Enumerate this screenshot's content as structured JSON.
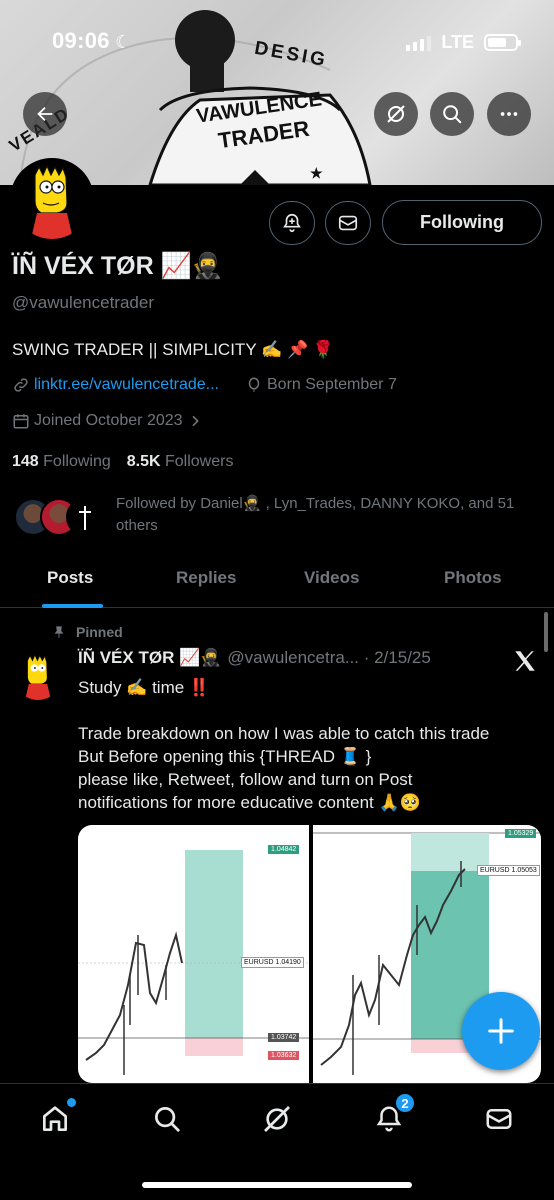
{
  "status_bar": {
    "time": "09:06",
    "network": "LTE"
  },
  "banner": {
    "arc_text_left": "VEALD",
    "arc_text_right": "DESIG",
    "shirt_line1": "VAWULENCE",
    "shirt_line2": "TRADER"
  },
  "profile": {
    "name": "ÏÑ VÉX TØR 📈🥷",
    "handle": "@vawulencetrader",
    "bio": "SWING TRADER || SIMPLICITY ✍️ 📌 🌹",
    "link": "linktr.ee/vawulencetrade...",
    "born": "Born September 7",
    "joined": "Joined October 2023",
    "following_count": "148",
    "following_label": "Following",
    "followers_count": "8.5K",
    "followers_label": "Followers",
    "followed_by": "Followed by Daniel🥷 , Lyn_Trades, DANNY KOKO, and 51 others",
    "follow_button": "Following"
  },
  "tabs": [
    {
      "label": "Posts",
      "active": true
    },
    {
      "label": "Replies",
      "active": false
    },
    {
      "label": "Videos",
      "active": false
    },
    {
      "label": "Photos",
      "active": false
    }
  ],
  "post": {
    "pinned_label": "Pinned",
    "author": "ÏÑ VÉX TØR 📈🥷",
    "handle_date": "@vawulencetra... · 2/15/25",
    "text_lines": [
      "Study ✍️ time ‼️",
      "",
      "Trade breakdown on how I was able to catch this trade",
      "But Before opening this {THREAD 🧵 }",
      "please like, Retweet, follow and turn on Post",
      "notifications for more educative content 🙏🥺"
    ],
    "chart1_labels": {
      "top": "1.04842",
      "mid_name": "EURUSD",
      "mid": "1.04190",
      "low1": "1.03742",
      "low2": "1.03632"
    },
    "chart2_labels": {
      "top": "1.05329",
      "mid_name": "EURUSD",
      "mid": "1.05053"
    }
  },
  "nav": {
    "notifications_badge": "2"
  },
  "colors": {
    "accent": "#1d9bf0",
    "background": "#000000",
    "muted": "#71767b",
    "border": "#2f3336"
  },
  "icons": [
    "back-arrow-icon",
    "grok-icon",
    "search-icon",
    "more-icon",
    "notification-add-icon",
    "message-icon",
    "link-icon",
    "balloon-icon",
    "calendar-icon",
    "chevron-right-icon",
    "pin-icon",
    "x-logo-icon",
    "plus-icon",
    "home-icon",
    "search-icon",
    "grok-icon",
    "bell-icon",
    "mail-icon"
  ]
}
